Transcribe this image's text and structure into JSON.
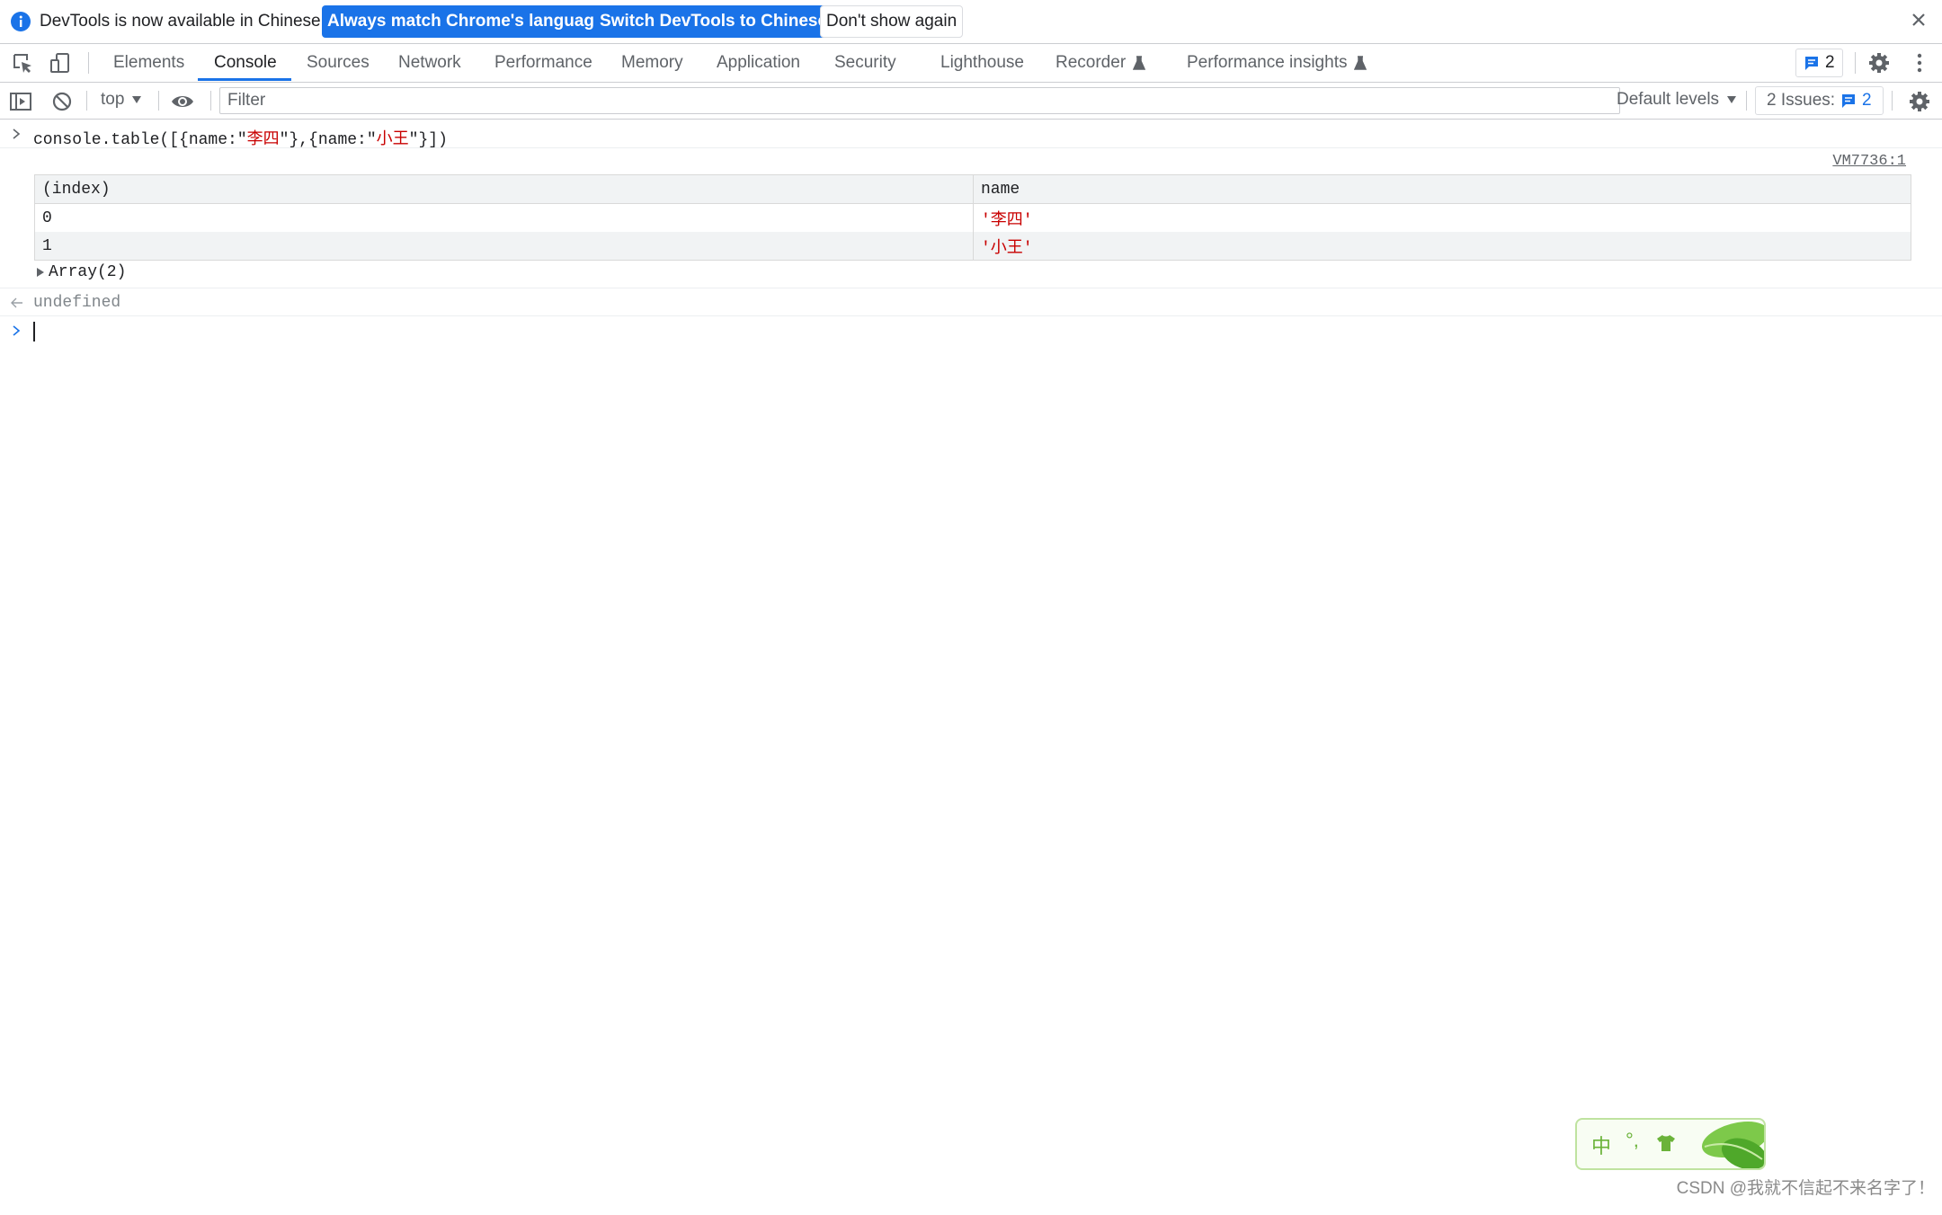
{
  "infobar": {
    "message": "DevTools is now available in Chinese!",
    "btn_match": "Always match Chrome's language",
    "btn_switch": "Switch DevTools to Chinese",
    "btn_dismiss": "Don't show again"
  },
  "tabs": [
    {
      "label": "Elements"
    },
    {
      "label": "Console",
      "active": true
    },
    {
      "label": "Sources"
    },
    {
      "label": "Network"
    },
    {
      "label": "Performance"
    },
    {
      "label": "Memory"
    },
    {
      "label": "Application"
    },
    {
      "label": "Security"
    },
    {
      "label": "Lighthouse"
    },
    {
      "label": "Recorder",
      "experimental": true
    },
    {
      "label": "Performance insights",
      "experimental": true
    }
  ],
  "tabbar_badge_count": "2",
  "console_toolbar": {
    "context": "top",
    "filter_placeholder": "Filter",
    "levels": "Default levels",
    "issues_label": "2 Issues:",
    "issues_count": "2"
  },
  "console": {
    "command_parts": [
      "console.table([{name:\"",
      "李四",
      "\"},{name:\"",
      "小王",
      "\"}])"
    ],
    "source_link": "VM7736:1",
    "table": {
      "headers": [
        "(index)",
        "name"
      ],
      "rows": [
        {
          "index": "0",
          "name": "'李四'"
        },
        {
          "index": "1",
          "name": "'小王'"
        }
      ]
    },
    "array_summary": "Array(2)",
    "result": "undefined"
  },
  "ime": {
    "mode": "中",
    "punct": "°,"
  },
  "watermark": "CSDN @我就不信起不来名字了！",
  "colors": {
    "accent": "#1a73e8",
    "string": "#c80000"
  }
}
